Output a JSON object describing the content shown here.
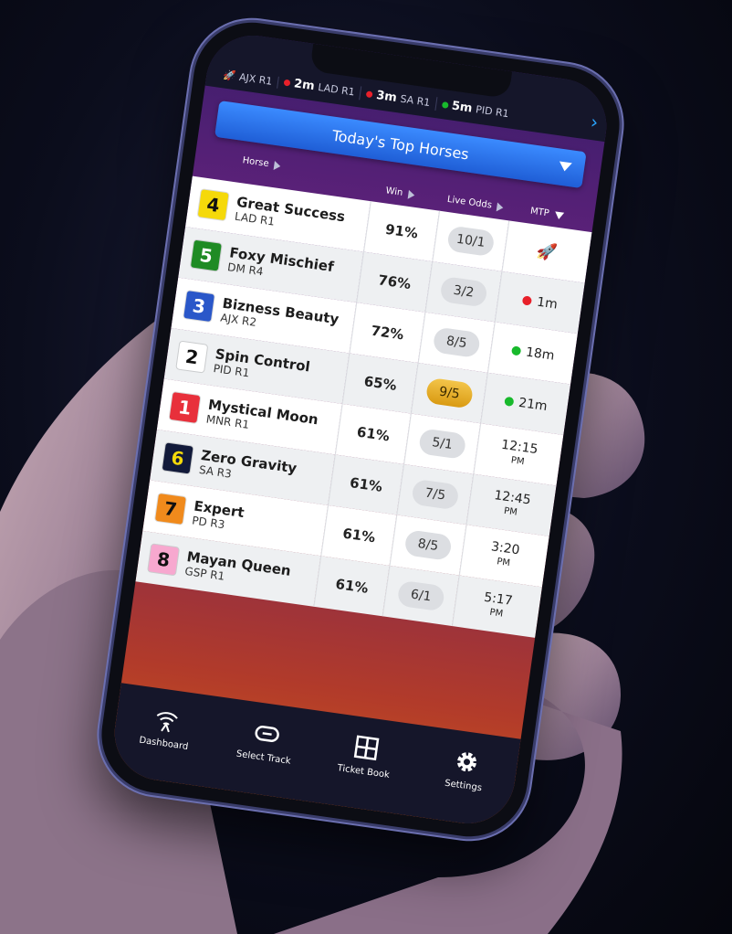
{
  "ticker": {
    "items": [
      {
        "time": "",
        "track": "AJX R1",
        "status": "rocket"
      },
      {
        "time": "2m",
        "track": "LAD R1",
        "status": "red"
      },
      {
        "time": "3m",
        "track": "SA R1",
        "status": "red"
      },
      {
        "time": "5m",
        "track": "PID R1",
        "status": "green"
      }
    ],
    "next_icon": "chevron-right-icon"
  },
  "dropdown": {
    "label": "Today's Top Horses"
  },
  "columns": {
    "horse": "Horse",
    "win": "Win",
    "odds": "Live Odds",
    "mtp": "MTP"
  },
  "rows": [
    {
      "num": "4",
      "num_bg": "#f5d90a",
      "num_fg": "#111111",
      "name": "Great Success",
      "track": "LAD R1",
      "win": "91%",
      "odds": "10/1",
      "odds_hot": false,
      "mtp": "rocket",
      "mtp_text": "",
      "mtp_sub": ""
    },
    {
      "num": "5",
      "num_bg": "#1f8b24",
      "num_fg": "#ffffff",
      "name": "Foxy Mischief",
      "track": "DM R4",
      "win": "76%",
      "odds": "3/2",
      "odds_hot": false,
      "mtp": "red",
      "mtp_text": "1m",
      "mtp_sub": ""
    },
    {
      "num": "3",
      "num_bg": "#2a57c9",
      "num_fg": "#ffffff",
      "name": "Bizness Beauty",
      "track": "AJX R2",
      "win": "72%",
      "odds": "8/5",
      "odds_hot": false,
      "mtp": "green",
      "mtp_text": "18m",
      "mtp_sub": ""
    },
    {
      "num": "2",
      "num_bg": "#ffffff",
      "num_fg": "#111111",
      "name": "Spin Control",
      "track": "PID R1",
      "win": "65%",
      "odds": "9/5",
      "odds_hot": true,
      "mtp": "green",
      "mtp_text": "21m",
      "mtp_sub": ""
    },
    {
      "num": "1",
      "num_bg": "#e8303b",
      "num_fg": "#ffffff",
      "name": "Mystical Moon",
      "track": "MNR R1",
      "win": "61%",
      "odds": "5/1",
      "odds_hot": false,
      "mtp": "time",
      "mtp_text": "12:15",
      "mtp_sub": "PM"
    },
    {
      "num": "6",
      "num_bg": "#121a3a",
      "num_fg": "#f5d90a",
      "name": "Zero Gravity",
      "track": "SA R3",
      "win": "61%",
      "odds": "7/5",
      "odds_hot": false,
      "mtp": "time",
      "mtp_text": "12:45",
      "mtp_sub": "PM"
    },
    {
      "num": "7",
      "num_bg": "#f08a1c",
      "num_fg": "#111111",
      "name": "Expert",
      "track": "PD R3",
      "win": "61%",
      "odds": "8/5",
      "odds_hot": false,
      "mtp": "time",
      "mtp_text": "3:20",
      "mtp_sub": "PM"
    },
    {
      "num": "8",
      "num_bg": "#f7a8cf",
      "num_fg": "#111111",
      "name": "Mayan Queen",
      "track": "GSP R1",
      "win": "61%",
      "odds": "6/1",
      "odds_hot": false,
      "mtp": "time",
      "mtp_text": "5:17",
      "mtp_sub": "PM"
    }
  ],
  "tabs": [
    {
      "label": "Dashboard",
      "icon": "wifi-icon"
    },
    {
      "label": "Select Track",
      "icon": "track-icon"
    },
    {
      "label": "Ticket Book",
      "icon": "grid-icon"
    },
    {
      "label": "Settings",
      "icon": "gear-icon"
    }
  ],
  "colors": {
    "accent": "#2f78f0",
    "red": "#e8202a",
    "green": "#18b92c",
    "hot": "#e6ad2b"
  }
}
